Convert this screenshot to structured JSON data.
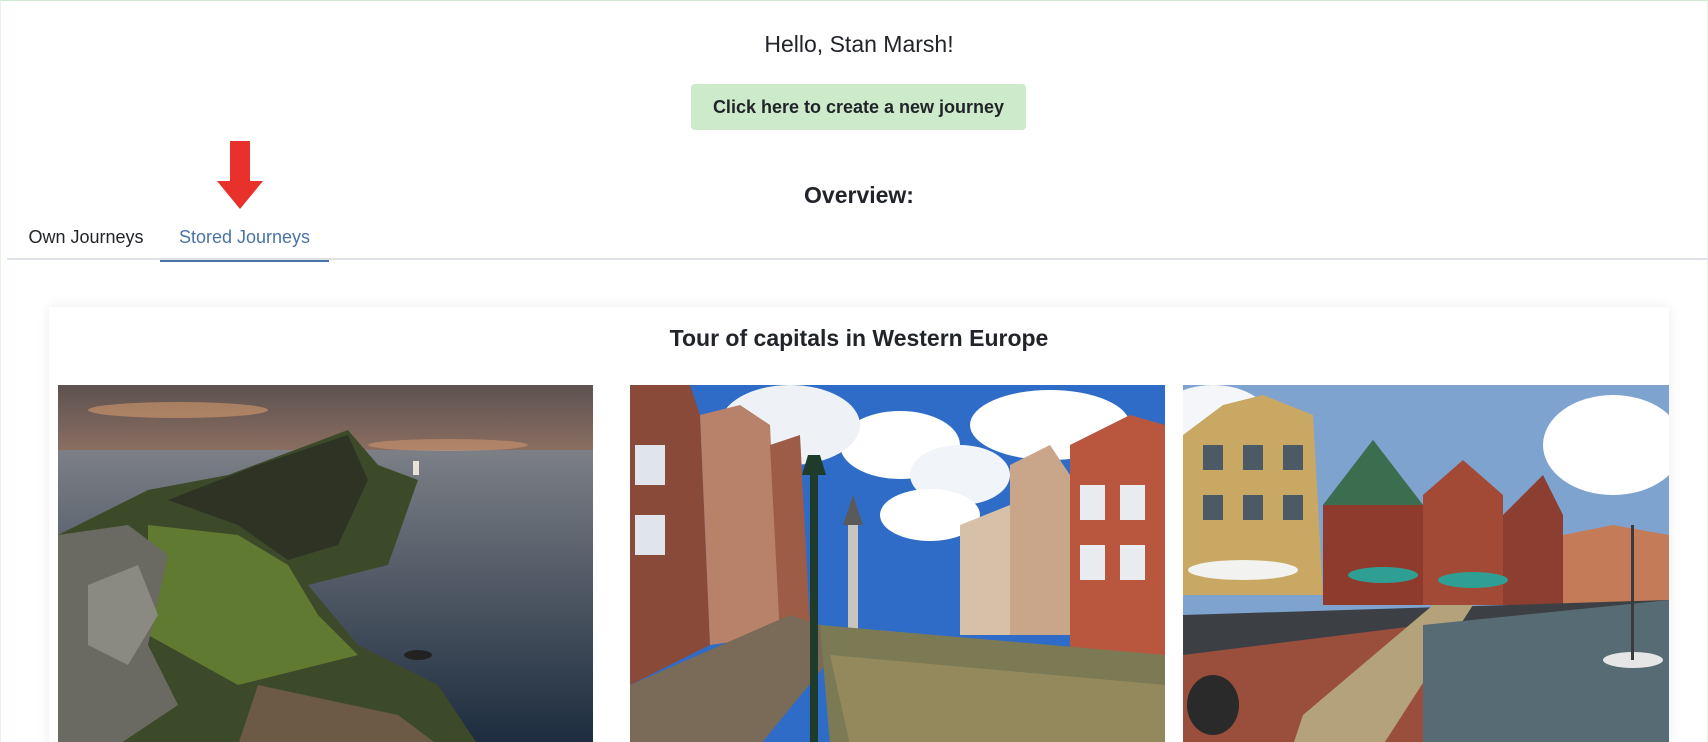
{
  "header": {
    "greeting": "Hello, Stan Marsh!",
    "create_button_label": "Click here to create a new journey",
    "overview_label": "Overview:"
  },
  "tabs": [
    {
      "label": "Own Journeys",
      "active": false
    },
    {
      "label": "Stored Journeys",
      "active": true
    }
  ],
  "journey_card": {
    "title": "Tour of capitals in Western Europe",
    "images": [
      "coastal-cliff-lighthouse-photo",
      "canal-street-photo",
      "half-timbered-harbor-photo"
    ]
  },
  "colors": {
    "accent": "#4a72a8",
    "button_bg": "#cdebcb",
    "arrow": "#e8312a"
  }
}
